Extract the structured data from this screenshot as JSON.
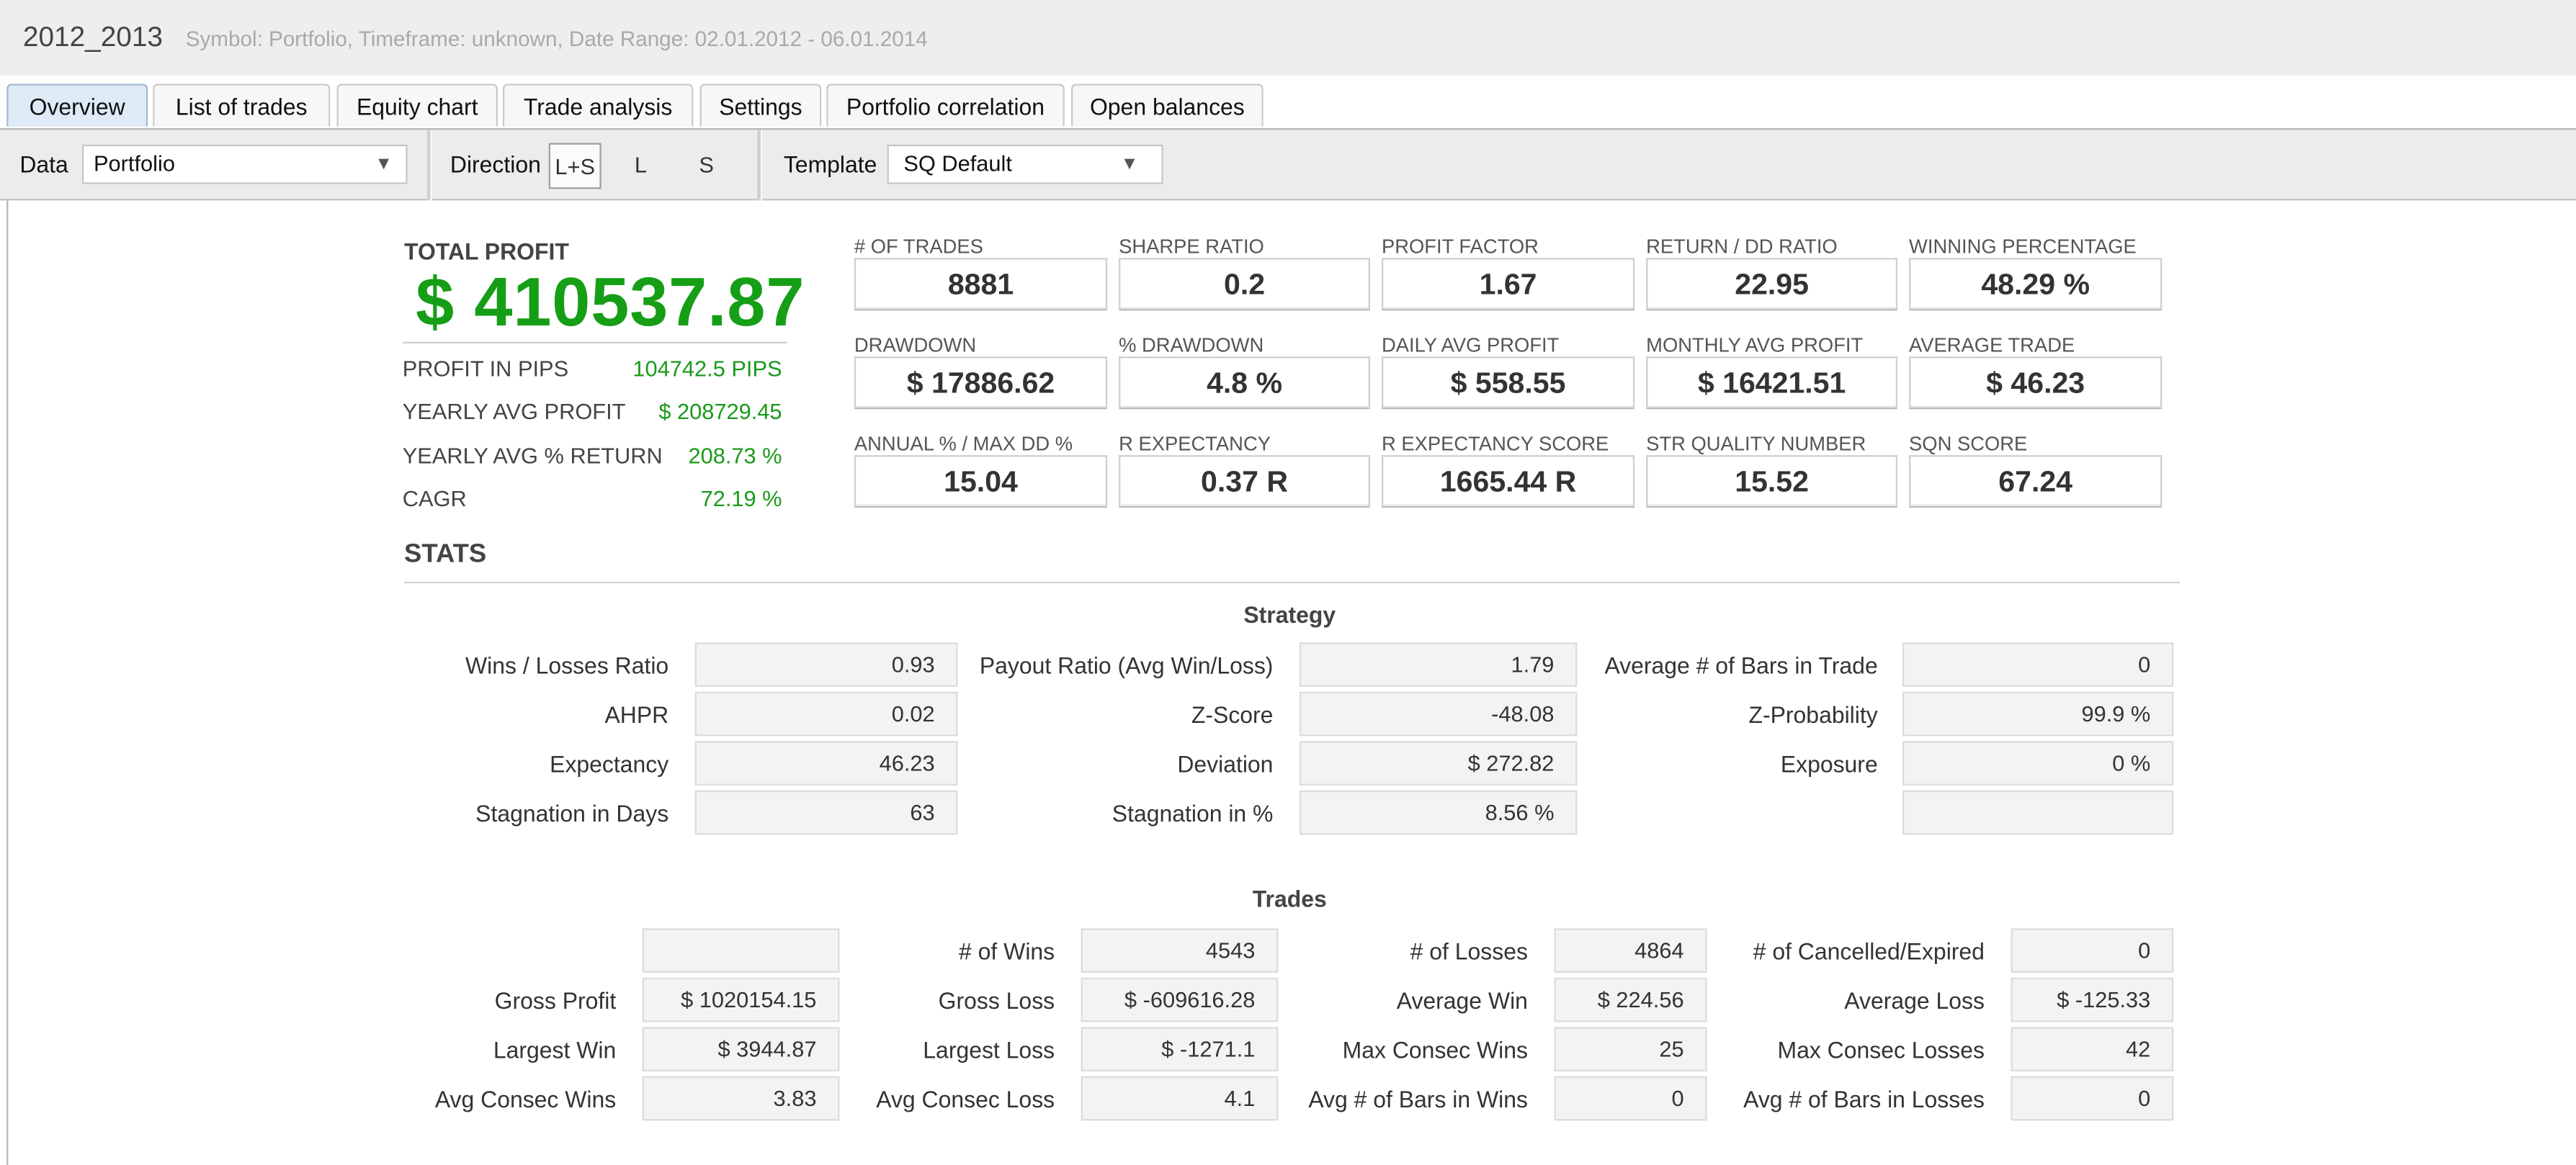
{
  "header": {
    "title": "2012_2013",
    "meta": "Symbol: Portfolio, Timeframe: unknown, Date Range: 02.01.2012 - 06.01.2014"
  },
  "tabs": [
    {
      "label": "Overview",
      "active": true
    },
    {
      "label": "List of trades"
    },
    {
      "label": "Equity chart"
    },
    {
      "label": "Trade analysis"
    },
    {
      "label": "Settings"
    },
    {
      "label": "Portfolio correlation"
    },
    {
      "label": "Open balances"
    }
  ],
  "toolbar": {
    "data_label": "Data",
    "data_value": "Portfolio",
    "direction_label": "Direction",
    "direction_options": [
      "L+S",
      "L",
      "S"
    ],
    "direction_selected": "L+S",
    "template_label": "Template",
    "template_value": "SQ Default",
    "dropdown_glyph": "▼"
  },
  "summary": {
    "total_profit_label": "TOTAL PROFIT",
    "total_profit_value": "$ 410537.87",
    "rows": [
      {
        "label": "PROFIT IN PIPS",
        "value": "104742.5 PIPS"
      },
      {
        "label": "YEARLY AVG PROFIT",
        "value": "$ 208729.45"
      },
      {
        "label": "YEARLY AVG % RETURN",
        "value": "208.73 %"
      },
      {
        "label": "CAGR",
        "value": "72.19 %"
      }
    ]
  },
  "kpis": [
    {
      "label": "# OF TRADES",
      "value": "8881"
    },
    {
      "label": "SHARPE RATIO",
      "value": "0.2"
    },
    {
      "label": "PROFIT FACTOR",
      "value": "1.67"
    },
    {
      "label": "RETURN / DD RATIO",
      "value": "22.95"
    },
    {
      "label": "WINNING PERCENTAGE",
      "value": "48.29 %"
    },
    {
      "label": "DRAWDOWN",
      "value": "$ 17886.62"
    },
    {
      "label": "% DRAWDOWN",
      "value": "4.8 %"
    },
    {
      "label": "DAILY AVG PROFIT",
      "value": "$ 558.55"
    },
    {
      "label": "MONTHLY AVG PROFIT",
      "value": "$ 16421.51"
    },
    {
      "label": "AVERAGE TRADE",
      "value": "$ 46.23"
    },
    {
      "label": "ANNUAL % / MAX DD %",
      "value": "15.04"
    },
    {
      "label": "R EXPECTANCY",
      "value": "0.37 R"
    },
    {
      "label": "R EXPECTANCY SCORE",
      "value": "1665.44 R"
    },
    {
      "label": "STR QUALITY NUMBER",
      "value": "15.52"
    },
    {
      "label": "SQN SCORE",
      "value": "67.24"
    }
  ],
  "stats": {
    "title": "STATS",
    "strategy": {
      "title": "Strategy",
      "rows": [
        [
          {
            "label": "Wins / Losses Ratio",
            "value": "0.93"
          },
          {
            "label": "Payout Ratio (Avg Win/Loss)",
            "value": "1.79"
          },
          {
            "label": "Average # of Bars in Trade",
            "value": "0"
          }
        ],
        [
          {
            "label": "AHPR",
            "value": "0.02"
          },
          {
            "label": "Z-Score",
            "value": "-48.08"
          },
          {
            "label": "Z-Probability",
            "value": "99.9 %"
          }
        ],
        [
          {
            "label": "Expectancy",
            "value": "46.23"
          },
          {
            "label": "Deviation",
            "value": "$ 272.82"
          },
          {
            "label": "Exposure",
            "value": "0 %"
          }
        ],
        [
          {
            "label": "Stagnation in Days",
            "value": "63"
          },
          {
            "label": "Stagnation in %",
            "value": "8.56 %"
          },
          {
            "label": "",
            "value": ""
          }
        ]
      ]
    },
    "trades": {
      "title": "Trades",
      "rows": [
        [
          {
            "label": "",
            "value": ""
          },
          {
            "label": "# of Wins",
            "value": "4543"
          },
          {
            "label": "# of Losses",
            "value": "4864"
          },
          {
            "label": "# of Cancelled/Expired",
            "value": "0"
          }
        ],
        [
          {
            "label": "Gross Profit",
            "value": "$ 1020154.15"
          },
          {
            "label": "Gross Loss",
            "value": "$ -609616.28"
          },
          {
            "label": "Average Win",
            "value": "$ 224.56"
          },
          {
            "label": "Average Loss",
            "value": "$ -125.33"
          }
        ],
        [
          {
            "label": "Largest Win",
            "value": "$ 3944.87"
          },
          {
            "label": "Largest Loss",
            "value": "$ -1271.1"
          },
          {
            "label": "Max Consec Wins",
            "value": "25"
          },
          {
            "label": "Max Consec Losses",
            "value": "42"
          }
        ],
        [
          {
            "label": "Avg Consec Wins",
            "value": "3.83"
          },
          {
            "label": "Avg Consec Loss",
            "value": "4.1"
          },
          {
            "label": "Avg # of Bars in Wins",
            "value": "0"
          },
          {
            "label": "Avg # of Bars in Losses",
            "value": "0"
          }
        ]
      ]
    }
  }
}
